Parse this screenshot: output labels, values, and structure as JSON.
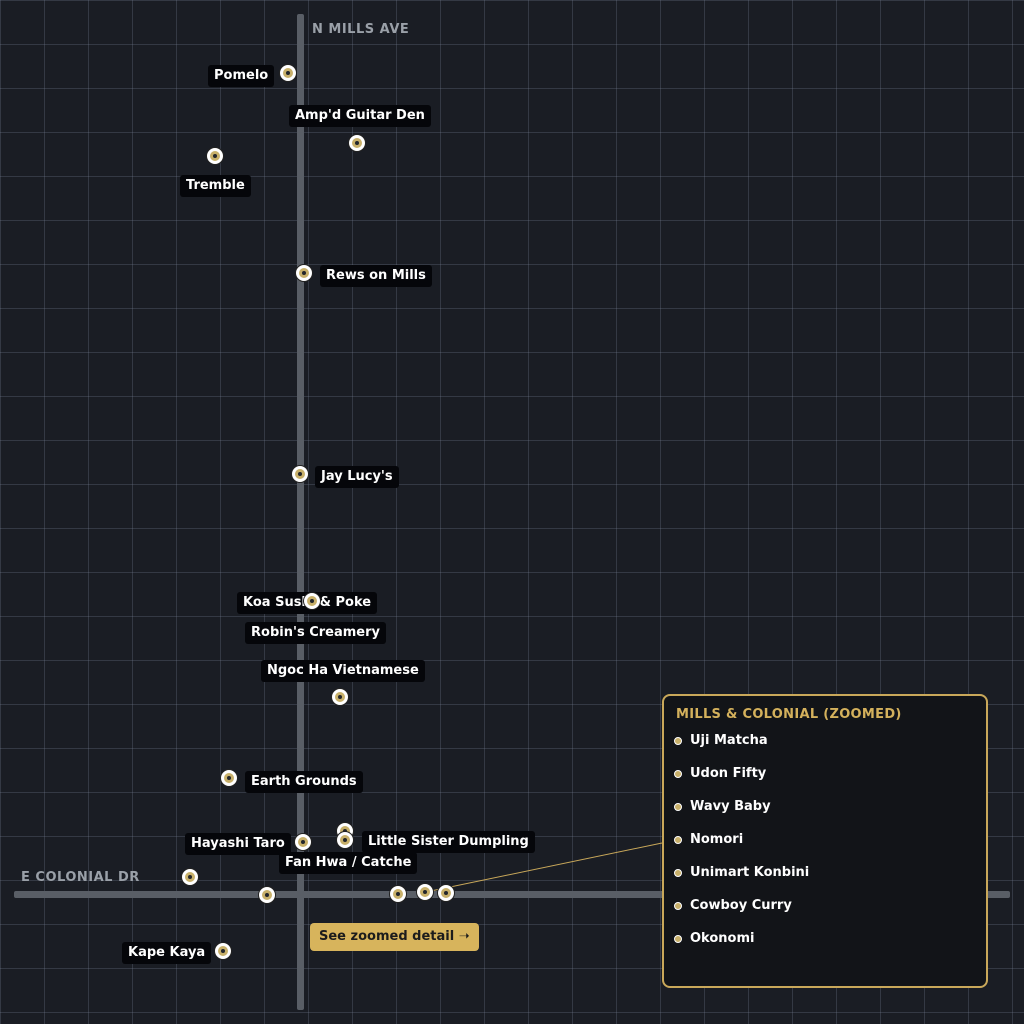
{
  "roads": {
    "vertical": "N MILLS AVE",
    "horizontal": "E COLONIAL DR"
  },
  "places": [
    {
      "id": "pomelo",
      "name": "Pomelo"
    },
    {
      "id": "ampd-guitar-den",
      "name": "Amp'd Guitar Den"
    },
    {
      "id": "tremble",
      "name": "Tremble"
    },
    {
      "id": "rews-on-mills",
      "name": "Rews on Mills"
    },
    {
      "id": "jay-lucys",
      "name": "Jay Lucy's"
    },
    {
      "id": "koa-sushi-poke",
      "name": "Koa Sushi & Poke"
    },
    {
      "id": "robins-creamery",
      "name": "Robin's Creamery"
    },
    {
      "id": "ngoc-ha-vietnamese",
      "name": "Ngoc Ha Vietnamese"
    },
    {
      "id": "earth-grounds",
      "name": "Earth Grounds"
    },
    {
      "id": "hayashi-taro",
      "name": "Hayashi Taro"
    },
    {
      "id": "little-sister-dumpling",
      "name": "Little Sister Dumpling"
    },
    {
      "id": "fan-hwa-catche",
      "name": "Fan Hwa / Catche"
    },
    {
      "id": "kape-kaya",
      "name": "Kape Kaya"
    }
  ],
  "zoom_button": {
    "label": "See zoomed detail ➝"
  },
  "inset": {
    "title": "MILLS & COLONIAL (ZOOMED)",
    "items": [
      "Uji Matcha",
      "Udon Fifty",
      "Wavy Baby",
      "Nomori",
      "Unimart Konbini",
      "Cowboy Curry",
      "Okonomi"
    ]
  },
  "colors": {
    "background": "#1a1d24",
    "road": "#595e66",
    "pin_fill": "#c8b06a",
    "accent_gold": "#d7b45c",
    "label_bg": "#05060a"
  }
}
